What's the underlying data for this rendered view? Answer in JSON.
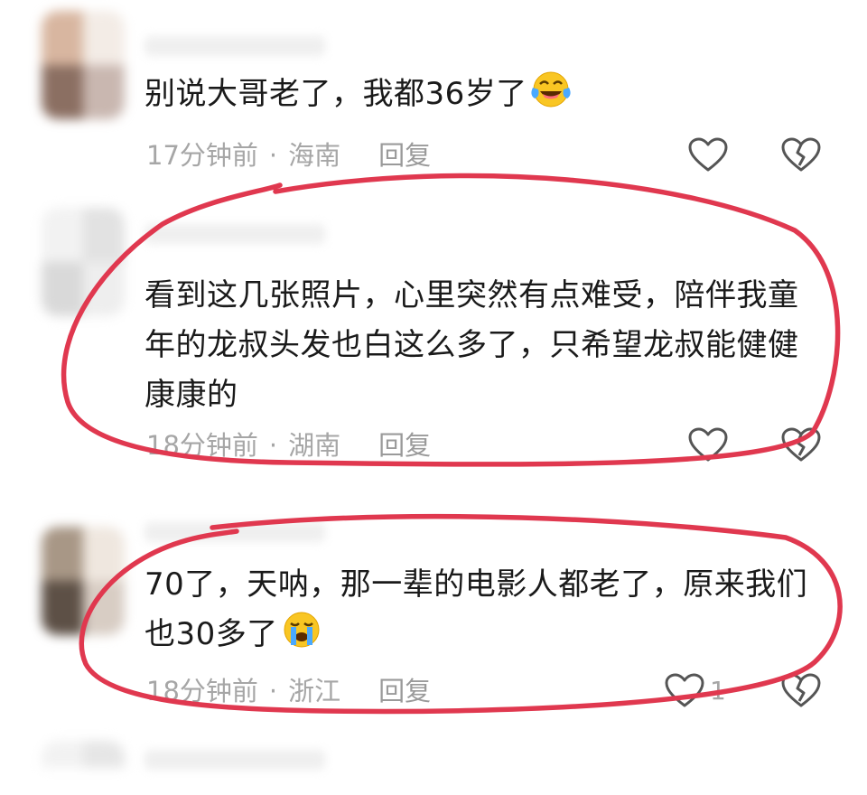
{
  "comments": [
    {
      "text": "别说大哥老了，我都36岁了",
      "time": "17分钟前",
      "separator": "·",
      "location": "海南",
      "reply": "回复",
      "emoji": "laughing-crying-emoji"
    },
    {
      "text": "看到这几张照片，心里突然有点难受，陪伴我童年的龙叔头发也白这么多了，只希望龙叔能健健康康的",
      "time": "18分钟前",
      "separator": "·",
      "location": "湖南",
      "reply": "回复"
    },
    {
      "text": "70了，天呐，那一辈的电影人都老了，原来我们也30多了",
      "time": "18分钟前",
      "separator": "·",
      "location": "浙江",
      "reply": "回复",
      "like_count": "1",
      "emoji": "crying-emoji"
    }
  ],
  "colors": {
    "annotation": "#e0384f",
    "meta": "#a6a6a6",
    "text": "#1a1a1a"
  },
  "icons": [
    "heart-outline-icon",
    "broken-heart-icon"
  ]
}
